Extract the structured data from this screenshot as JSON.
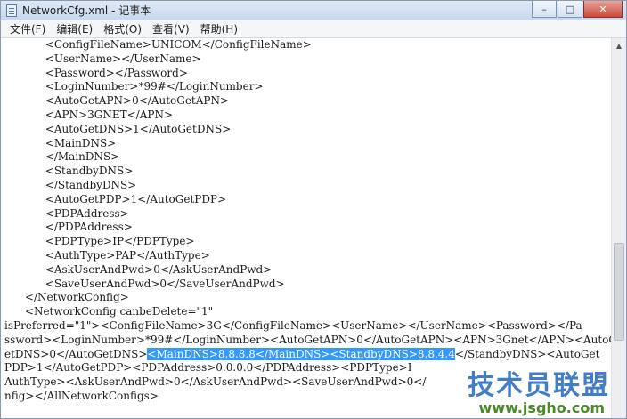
{
  "window": {
    "title": "NetworkCfg.xml - 记事本",
    "controls": [
      "–",
      "□",
      "✕"
    ]
  },
  "menu": [
    {
      "label": "文件(F)"
    },
    {
      "label": "编辑(E)"
    },
    {
      "label": "格式(O)"
    },
    {
      "label": "查看(V)"
    },
    {
      "label": "帮助(H)"
    }
  ],
  "editor": {
    "lines": [
      "            <ConfigFileName>UNICOM</ConfigFileName>",
      "            <UserName></UserName>",
      "            <Password></Password>",
      "            <LoginNumber>*99#</LoginNumber>",
      "            <AutoGetAPN>0</AutoGetAPN>",
      "            <APN>3GNET</APN>",
      "            <AutoGetDNS>1</AutoGetDNS>",
      "            <MainDNS>",
      "            </MainDNS>",
      "            <StandbyDNS>",
      "            </StandbyDNS>",
      "            <AutoGetPDP>1</AutoGetPDP>",
      "            <PDPAddress>",
      "            </PDPAddress>",
      "            <PDPType>IP</PDPType>",
      "            <AuthType>PAP</AuthType>",
      "            <AskUserAndPwd>0</AskUserAndPwd>",
      "            <SaveUserAndPwd>0</SaveUserAndPwd>",
      "      </NetworkConfig>",
      "      <NetworkConfig canbeDelete=\"1\"",
      "isPreferred=\"1\"><ConfigFileName>3G</ConfigFileName><UserName></UserName><Password></Pa",
      "ssword><LoginNumber>*99#</LoginNumber><AutoGetAPN>0</AutoGetAPN><APN>3Gnet</APN><AutoG",
      "etDNS>0</AutoGetDNS>",
      "PDP>1</AutoGetPDP><PDPAddress>0.0.0.0</PDPAddress><PDPType>I",
      "AuthType><AskUserAndPwd>0</AskUserAndPwd><SaveUserAndPwd>0</",
      "nfig></AllNetworkConfigs>"
    ],
    "selected": "<MainDNS>8.8.8.8</MainDNS><StandbyDNS>8.8.4.4",
    "after_selected": "</StandbyDNS><AutoGet"
  },
  "watermark": {
    "text": "技术员联盟",
    "url": "www.jsgho.com"
  }
}
